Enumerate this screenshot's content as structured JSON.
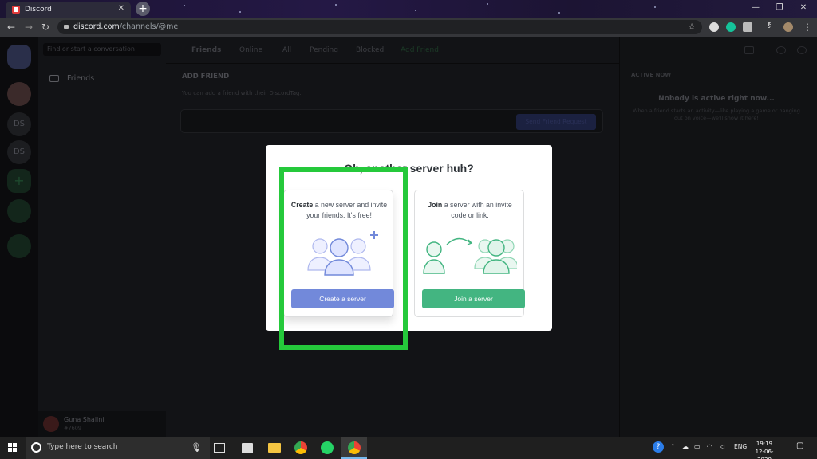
{
  "browser": {
    "tab_title": "Discord",
    "tab_close": "✕",
    "new_tab": "+",
    "url_host": "discord.com",
    "url_path": "/channels/@me"
  },
  "discord": {
    "search_placeholder": "Find or start a conversation",
    "friends_label": "Friends",
    "header_tabs": [
      "Friends",
      "Online",
      "All",
      "Pending",
      "Blocked",
      "Add Friend"
    ],
    "add_friend_title": "ADD FRIEND",
    "add_friend_subtitle": "You can add a friend with their DiscordTag.",
    "send_request": "Send Friend Request",
    "active_now": "ACTIVE NOW",
    "active_title": "Nobody is active right now...",
    "active_desc": "When a friend starts an activity—like playing a game or hanging out on voice—we'll show it here!",
    "guild_ds1": "DS",
    "guild_ds2": "DS",
    "user_name": "Guna Shalini",
    "user_tag": "#7609"
  },
  "modal": {
    "title": "Oh, another server huh?",
    "create_bold": "Create",
    "create_rest": " a new server and invite your friends. It's free!",
    "create_button": "Create a server",
    "join_bold": "Join",
    "join_rest": " a server with an invite code or link.",
    "join_button": "Join a server"
  },
  "taskbar": {
    "search_placeholder": "Type here to search",
    "lang": "ENG",
    "time": "19:19",
    "date": "12-06-2020"
  },
  "colors": {
    "blurple": "#7289da",
    "green": "#43b581",
    "highlight": "#25c93b"
  }
}
